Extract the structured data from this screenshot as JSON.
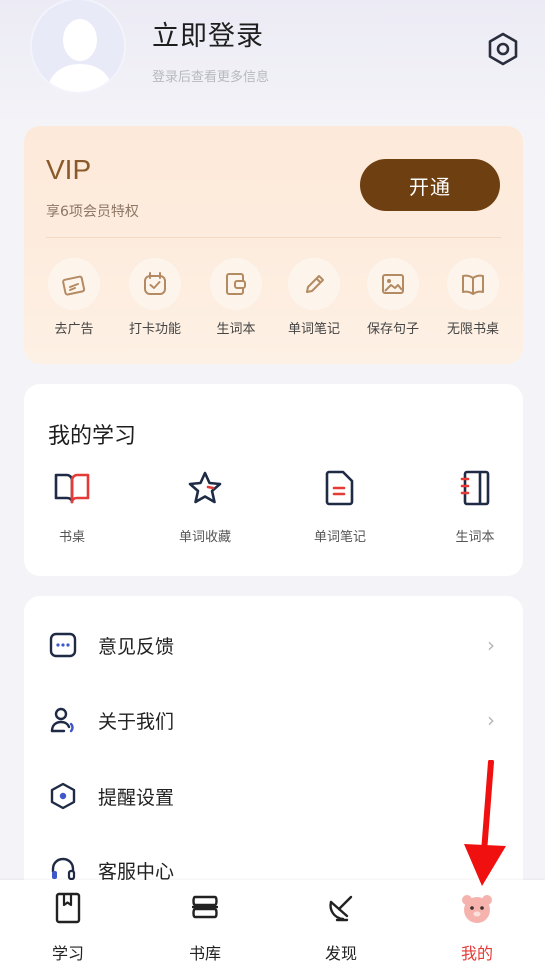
{
  "header": {
    "login_title": "立即登录",
    "login_subtitle": "登录后查看更多信息"
  },
  "vip": {
    "title": "VIP",
    "subtitle": "享6项会员特权",
    "button": "开通",
    "perks": [
      {
        "label": "去广告",
        "icon": "ad-icon"
      },
      {
        "label": "打卡功能",
        "icon": "checkin-icon"
      },
      {
        "label": "生词本",
        "icon": "wallet-icon"
      },
      {
        "label": "单词笔记",
        "icon": "pencil-icon"
      },
      {
        "label": "保存句子",
        "icon": "image-icon"
      },
      {
        "label": "无限书桌",
        "icon": "book-icon"
      }
    ]
  },
  "study": {
    "title": "我的学习",
    "items": [
      {
        "label": "书桌",
        "icon": "book-open-icon"
      },
      {
        "label": "单词收藏",
        "icon": "star-icon"
      },
      {
        "label": "单词笔记",
        "icon": "note-icon"
      },
      {
        "label": "生词本",
        "icon": "notebook-icon"
      }
    ]
  },
  "menu": {
    "items": [
      {
        "label": "意见反馈",
        "icon": "feedback-icon"
      },
      {
        "label": "关于我们",
        "icon": "user-icon"
      },
      {
        "label": "提醒设置",
        "icon": "hexagon-icon"
      },
      {
        "label": "客服中心",
        "icon": "headset-icon"
      }
    ]
  },
  "tabbar": {
    "tabs": [
      {
        "label": "学习",
        "icon": "study-icon"
      },
      {
        "label": "书库",
        "icon": "library-icon"
      },
      {
        "label": "发现",
        "icon": "discover-icon"
      },
      {
        "label": "我的",
        "icon": "bear-icon"
      }
    ],
    "active": "我的"
  },
  "colors": {
    "accent_red": "#e63a36",
    "vip_brown": "#6e3f10",
    "perk_icon": "#b48a63"
  }
}
